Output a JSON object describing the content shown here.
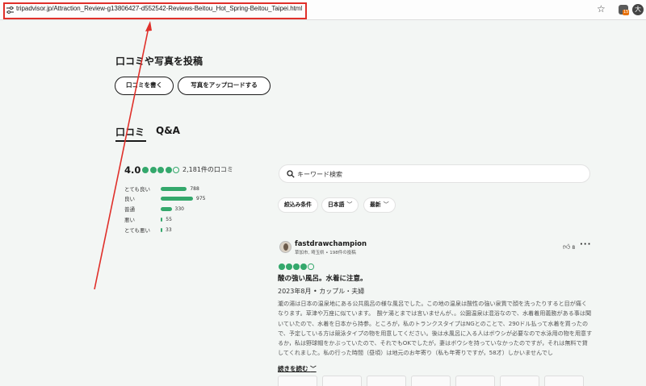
{
  "browser": {
    "url": "tripadvisor.jp/Attraction_Review-g13806427-d552542-Reviews-Beitou_Hot_Spring-Beitou_Taipei.html",
    "profile_initial": "大",
    "extension_badge": "15"
  },
  "post_section": {
    "title": "口コミや写真を投稿",
    "write_review_label": "口コミを書く",
    "upload_photo_label": "写真をアップロードする"
  },
  "tabs": [
    {
      "label": "口コミ",
      "selected": true
    },
    {
      "label": "Q&A",
      "selected": false
    }
  ],
  "rating": {
    "score": "4.0",
    "bubbles_filled": 4,
    "bubbles_total": 5,
    "count_label": "2,181件の口コミ",
    "distribution": [
      {
        "label": "とても良い",
        "count": "788",
        "value": 788
      },
      {
        "label": "良い",
        "count": "975",
        "value": 975
      },
      {
        "label": "普通",
        "count": "330",
        "value": 330
      },
      {
        "label": "悪い",
        "count": "55",
        "value": 55
      },
      {
        "label": "とても悪い",
        "count": "33",
        "value": 33
      }
    ]
  },
  "search": {
    "placeholder": "キーワード検索"
  },
  "filters": {
    "filter_label": "絞込み条件",
    "language_label": "日本語",
    "sort_label": "最新"
  },
  "review": {
    "author": "fastdrawchampion",
    "author_meta": "草加市, 埼玉県 • 198件の投稿",
    "helpful_count": "8",
    "bubbles_filled": 4,
    "title": "酸の強い風呂。水着に注意。",
    "date_trip": "2023年8月 • カップル・夫婦",
    "body": "瀧の湯は日本の温泉地にある公共風呂の様な風呂でした。この地の温泉は酸性の強い泉質で顔を洗ったりすると目が痛くなります。草津や万座に似ています。　酸ケ湯とまでは言いませんが、。公園温泉は混浴なので、水着着用義務がある事は聞いていたので、水着を日本から持参。ところが，私のトランクスタイプはNGとのことで、290ドル払って水着を買ったので、予定している方は競泳タイプの物を用意してください。後は水風呂に入る人はボウシが必要なので水泳用の物を用意するか，私は野球帽をかぶっていたので、それでもOKでしたが，妻はボウシを持っていなかったのですが，それは無料で貸してくれました。私の行った時間（昼頃）は地元のお年寄り（私も年寄りですが，58才）しかいませんでし",
    "read_more_label": "続きを読む"
  },
  "colors": {
    "accent": "#34a86c",
    "annotation": "#e0302a"
  }
}
